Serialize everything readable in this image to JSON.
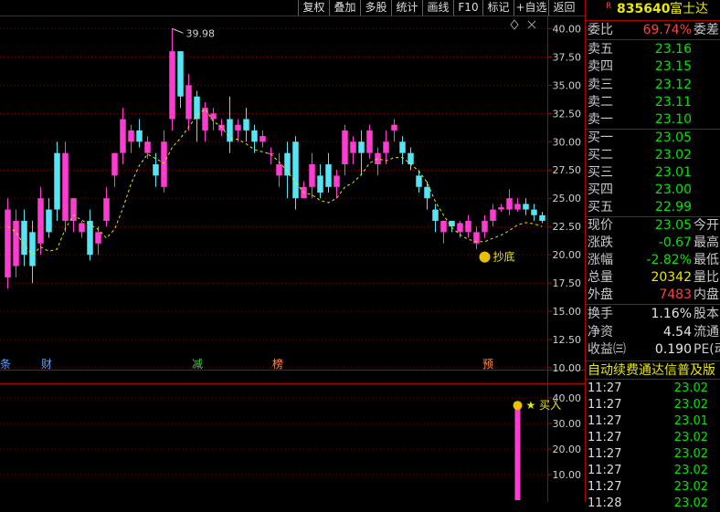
{
  "toolbar": {
    "buttons": [
      "复权",
      "叠加",
      "多股",
      "统计",
      "画线",
      "F10",
      "标记",
      "+自选",
      "返回"
    ]
  },
  "header": {
    "badge": "R",
    "code": "835640",
    "name": "富士达"
  },
  "quote": {
    "weibi_label": "委比",
    "weibi_value": "69.74%",
    "weicha_label": "委差",
    "sell": [
      {
        "label": "卖五",
        "price": "23.16"
      },
      {
        "label": "卖四",
        "price": "23.15"
      },
      {
        "label": "卖三",
        "price": "23.12"
      },
      {
        "label": "卖二",
        "price": "23.11"
      },
      {
        "label": "卖一",
        "price": "23.10"
      }
    ],
    "buy": [
      {
        "label": "买一",
        "price": "23.05"
      },
      {
        "label": "买二",
        "price": "23.02"
      },
      {
        "label": "买三",
        "price": "23.01"
      },
      {
        "label": "买四",
        "price": "23.00"
      },
      {
        "label": "买五",
        "price": "22.99"
      }
    ],
    "stats": [
      {
        "label": "现价",
        "value": "23.05",
        "right": "今开",
        "color": "green"
      },
      {
        "label": "涨跌",
        "value": "-0.67",
        "right": "最高",
        "color": "green"
      },
      {
        "label": "涨幅",
        "value": "-2.82%",
        "right": "最低",
        "color": "green"
      },
      {
        "label": "总量",
        "value": "20342",
        "right": "量比",
        "color": "yellow"
      },
      {
        "label": "外盘",
        "value": "7483",
        "right": "内盘",
        "color": "red"
      }
    ],
    "stats2": [
      {
        "label": "换手",
        "value": "1.16%",
        "right": "股本"
      },
      {
        "label": "净资",
        "value": "4.54",
        "right": "流通"
      },
      {
        "label": "收益㈢",
        "value": "0.190",
        "right": "PE(动"
      }
    ],
    "marquee": "自动续费通达信普及版",
    "ticks": [
      {
        "time": "11:27",
        "price": "23.02"
      },
      {
        "time": "11:27",
        "price": "23.02"
      },
      {
        "time": "11:27",
        "price": "23.01"
      },
      {
        "time": "11:27",
        "price": "23.02"
      },
      {
        "time": "11:27",
        "price": "23.02"
      },
      {
        "time": "11:27",
        "price": "23.02"
      },
      {
        "time": "11:27",
        "price": "23.02"
      },
      {
        "time": "11:28",
        "price": "23.02"
      }
    ]
  },
  "chart_data": [
    {
      "type": "candlestick",
      "ylim": [
        10,
        41
      ],
      "y_ticks": [
        "40.00",
        "37.50",
        "35.00",
        "32.50",
        "30.00",
        "27.50",
        "25.00",
        "22.50",
        "20.00",
        "17.50",
        "15.00",
        "12.50",
        "10.00"
      ],
      "high_annotation": "39.98",
      "signal_label": "抄底",
      "event_tags": [
        "条",
        "财",
        "减",
        "榜",
        "预"
      ],
      "candles": [
        [
          18,
          24,
          17,
          25
        ],
        [
          19,
          23,
          18,
          24
        ],
        [
          23,
          20,
          19,
          24
        ],
        [
          22,
          19,
          17.5,
          23
        ],
        [
          21,
          25,
          20,
          26
        ],
        [
          24,
          22,
          21.5,
          25
        ],
        [
          29,
          24,
          23,
          30
        ],
        [
          23,
          29,
          22,
          30
        ],
        [
          23,
          25,
          22,
          25
        ],
        [
          22,
          22.8,
          21.5,
          23
        ],
        [
          23,
          20,
          19.5,
          24
        ],
        [
          21,
          22,
          20,
          22.5
        ],
        [
          23,
          25,
          22.5,
          26
        ],
        [
          27,
          29,
          26,
          28
        ],
        [
          29,
          32,
          28,
          33
        ],
        [
          30,
          31,
          29,
          31.5
        ],
        [
          31,
          30,
          29.5,
          32
        ],
        [
          29,
          30,
          28.5,
          30.5
        ],
        [
          28,
          27,
          26,
          29
        ],
        [
          26,
          30,
          25.5,
          31
        ],
        [
          32,
          38,
          31,
          40
        ],
        [
          38,
          34,
          33,
          38
        ],
        [
          32,
          35,
          31,
          36
        ],
        [
          34,
          32,
          30,
          34.5
        ],
        [
          31,
          33,
          30,
          33.5
        ],
        [
          32,
          32.5,
          31,
          33
        ],
        [
          31,
          31.5,
          30.5,
          32
        ],
        [
          32,
          30,
          29,
          34
        ],
        [
          31,
          31.5,
          30,
          32
        ],
        [
          32,
          31,
          30,
          33
        ],
        [
          31,
          30,
          29,
          31.5
        ],
        [
          30,
          30.5,
          29.5,
          31
        ],
        [
          29,
          29,
          28,
          29.5
        ],
        [
          27,
          28,
          26,
          29
        ],
        [
          29,
          27,
          25,
          30
        ],
        [
          30,
          25,
          24,
          30.5
        ],
        [
          25,
          26,
          25,
          26.5
        ],
        [
          26,
          28,
          25,
          29
        ],
        [
          27,
          25.5,
          25,
          28
        ],
        [
          28,
          26,
          25.5,
          29
        ],
        [
          26,
          27,
          25,
          27.5
        ],
        [
          28,
          31,
          27,
          31.5
        ],
        [
          29,
          30,
          28,
          30.5
        ],
        [
          30,
          29,
          27,
          31
        ],
        [
          29,
          31,
          28.5,
          31.5
        ],
        [
          28,
          29,
          27,
          29.5
        ],
        [
          29,
          30,
          28,
          31
        ],
        [
          31,
          31.5,
          30,
          32
        ],
        [
          30,
          29,
          28,
          30.5
        ],
        [
          29,
          28,
          27.5,
          29.5
        ],
        [
          27,
          26,
          25.5,
          27.5
        ],
        [
          26,
          25,
          24,
          26.5
        ],
        [
          24,
          23,
          22,
          24.5
        ],
        [
          22,
          23,
          21,
          23
        ],
        [
          23,
          22.5,
          22,
          23
        ],
        [
          22,
          22.8,
          21.5,
          23
        ],
        [
          22,
          23,
          21.5,
          23.5
        ],
        [
          21,
          22,
          20.5,
          22.5
        ],
        [
          22,
          23,
          21.5,
          23.5
        ],
        [
          23,
          24,
          22.5,
          24.5
        ],
        [
          24,
          24.2,
          23.8,
          24.5
        ],
        [
          24,
          25,
          23.5,
          25.8
        ],
        [
          24,
          24.5,
          23.8,
          25
        ],
        [
          24.5,
          24,
          23.5,
          25
        ],
        [
          24,
          23.5,
          23,
          24.5
        ],
        [
          23.5,
          23,
          22.8,
          23.8
        ]
      ]
    },
    {
      "type": "bar",
      "ylim": [
        0,
        45
      ],
      "y_ticks": [
        "40.00",
        "30.00",
        "20.00",
        "10.00"
      ],
      "signal_label": "★ 买入",
      "bars": [
        {
          "index": 62,
          "value": 36
        }
      ]
    }
  ]
}
